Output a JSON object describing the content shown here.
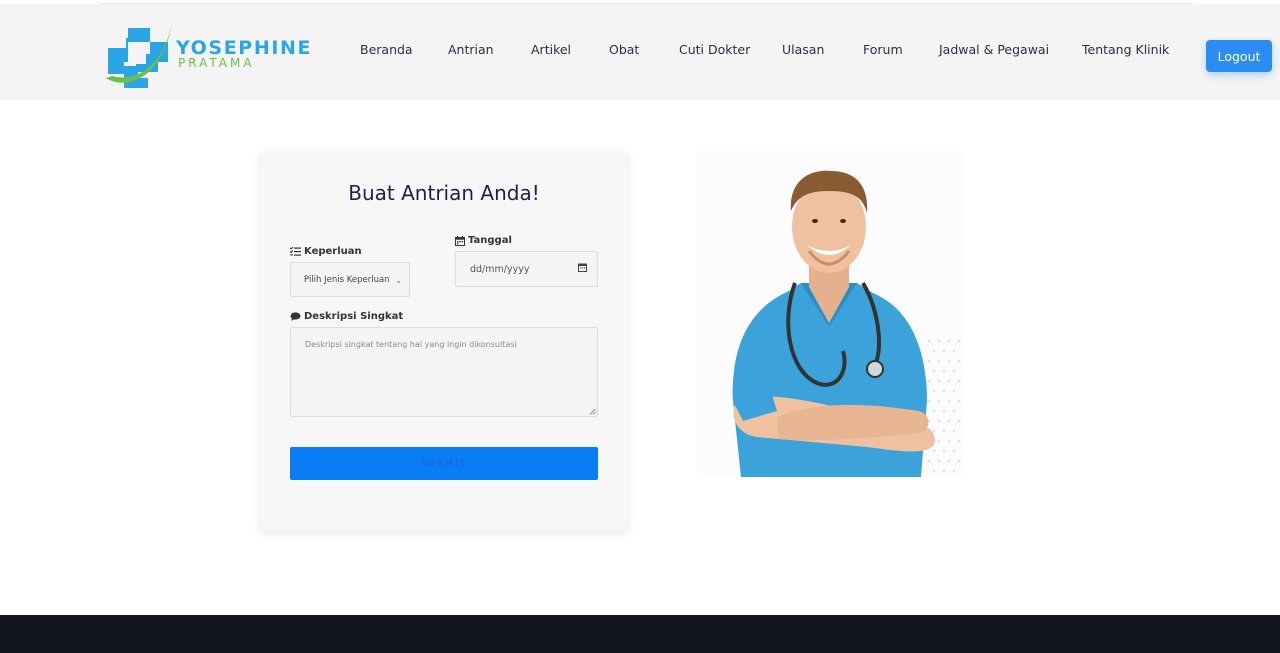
{
  "brand": {
    "name": "YOSEPHINE",
    "subname": "PRATAMA",
    "primary_color": "#2aa6e6",
    "accent_color": "#6ac04a",
    "logo_icon": "medical-cross-icon"
  },
  "nav": {
    "items": [
      {
        "label": "Beranda"
      },
      {
        "label": "Antrian"
      },
      {
        "label": "Artikel"
      },
      {
        "label": "Obat"
      },
      {
        "label": "Cuti Dokter"
      },
      {
        "label": "Ulasan"
      },
      {
        "label": "Forum"
      },
      {
        "label": "Jadwal & Pegawai"
      },
      {
        "label": "Tentang Klinik"
      }
    ],
    "logout_label": "Logout",
    "logout_color": "#2b8cf2"
  },
  "form": {
    "title": "Buat Antrian Anda!",
    "keperluan": {
      "label": "Keperluan",
      "icon": "list-check-icon",
      "selected": "Pilih Jenis Keperluan"
    },
    "tanggal": {
      "label": "Tanggal",
      "icon": "calendar-icon",
      "value": "dd/mm/yyyy"
    },
    "deskripsi": {
      "label": "Deskripsi Singkat",
      "icon": "comment-icon",
      "placeholder": "Deskripsi singkat tentang hal yang ingin dikonsultasi"
    },
    "submit_label": "SUBMIT",
    "submit_color": "#0a7df5"
  },
  "illustration": {
    "subject": "doctor-photo"
  },
  "footer": {
    "color": "#14161f"
  }
}
